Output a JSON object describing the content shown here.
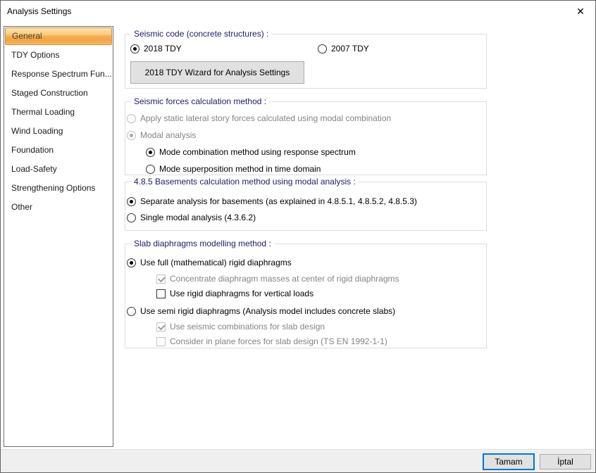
{
  "window": {
    "title": "Analysis Settings",
    "close_icon": "✕"
  },
  "sidebar": {
    "items": [
      {
        "label": "General",
        "selected": true
      },
      {
        "label": "TDY Options",
        "selected": false
      },
      {
        "label": "Response Spectrum Fun...",
        "selected": false
      },
      {
        "label": "Staged Construction",
        "selected": false
      },
      {
        "label": "Thermal Loading",
        "selected": false
      },
      {
        "label": "Wind Loading",
        "selected": false
      },
      {
        "label": "Foundation",
        "selected": false
      },
      {
        "label": "Load-Safety",
        "selected": false
      },
      {
        "label": "Strengthening Options",
        "selected": false
      },
      {
        "label": "Other",
        "selected": false
      }
    ]
  },
  "groups": {
    "seismic_code": {
      "title": "Seismic code (concrete structures) :",
      "radio_2018": "2018 TDY",
      "radio_2018_selected": true,
      "radio_2007": "2007 TDY",
      "radio_2007_selected": false,
      "wizard_button": "2018 TDY Wizard for Analysis Settings"
    },
    "forces_method": {
      "title": "Seismic forces calculation method :",
      "static_option": "Apply static lateral story forces calculated using modal combination",
      "static_option_state": "disabled unselected",
      "modal_option": "Modal analysis",
      "modal_option_state": "disabled selected",
      "mode_combination": "Mode combination method using response spectrum",
      "mode_combination_selected": true,
      "mode_superposition": "Mode superposition method in time domain",
      "mode_superposition_selected": false
    },
    "basements": {
      "title": "4.8.5 Basements calculation method using modal analysis :",
      "separate_option": "Separate analysis for basements (as explained in 4.8.5.1, 4.8.5.2, 4.8.5.3)",
      "separate_option_selected": true,
      "single_option": "Single modal analysis (4.3.6.2)",
      "single_option_selected": false
    },
    "slab_diaphragms": {
      "title": "Slab diaphragms modelling method :",
      "full_rigid_option": "Use full (mathematical) rigid diaphragms",
      "full_rigid_selected": true,
      "concentrate_masses": "Concentrate diaphragm masses at center of rigid diaphragms",
      "concentrate_masses_state": "checked disabled",
      "rigid_vertical": "Use rigid diaphragms for vertical loads",
      "rigid_vertical_state": "unchecked enabled",
      "semi_rigid_option": "Use semi rigid diaphragms (Analysis model includes concrete slabs)",
      "semi_rigid_selected": false,
      "seismic_combinations": "Use seismic combinations for slab design",
      "seismic_combinations_state": "checked disabled",
      "in_plane_forces": "Consider in plane forces for slab design (TS EN 1992-1-1)",
      "in_plane_forces_state": "unchecked disabled"
    }
  },
  "footer": {
    "ok_label": "Tamam",
    "cancel_label": "İptal"
  },
  "colors": {
    "selection_gradient_border": "#c79244",
    "selection_gradient_mid": "#f6ad52",
    "group_label": "#202066",
    "focus_button_border": "#0078d7",
    "disabled_text": "#848484",
    "footer_bg": "#efefef"
  }
}
